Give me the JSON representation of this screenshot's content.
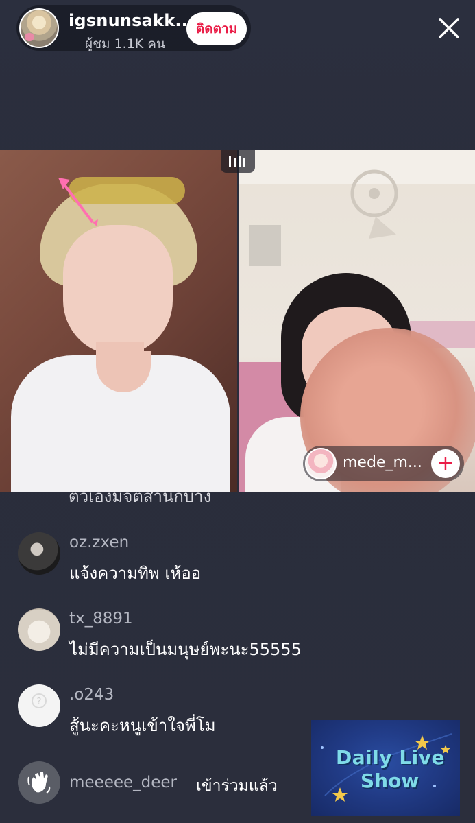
{
  "header": {
    "host_username": "igsnunsakk...",
    "viewers_label": "ผู้ชม 1.1K คน",
    "follow_label": "ติดตาม",
    "close_icon": "close-icon"
  },
  "video": {
    "layout_icon": "split-screen-icon",
    "guest_username": "mede_m...",
    "guest_add_icon": "plus-icon"
  },
  "comments": {
    "clipped_text": "ตัวเองมีจิตสำนึกบ้าง",
    "items": [
      {
        "user": "oz.zxen",
        "text": "แจ้งความทิพ เห้ออ"
      },
      {
        "user": "tx_8891",
        "text": "ไม่มีความเป็นมนุษย์พะนะ55555"
      },
      {
        "user": ".o243",
        "text": "สู้นะคะหนูเข้าใจพี่โม"
      }
    ],
    "join": {
      "user": "meeeee_deer",
      "text": "เข้าร่วมแล้ว",
      "icon": "wave-hand-icon"
    }
  },
  "badge": {
    "line1": "Daily Live",
    "line2": "Show"
  },
  "colors": {
    "background": "#2a2d3a",
    "follow_text": "#ea1d47",
    "username_gray": "#b4b7c2",
    "badge_text": "#7fdbe8"
  }
}
